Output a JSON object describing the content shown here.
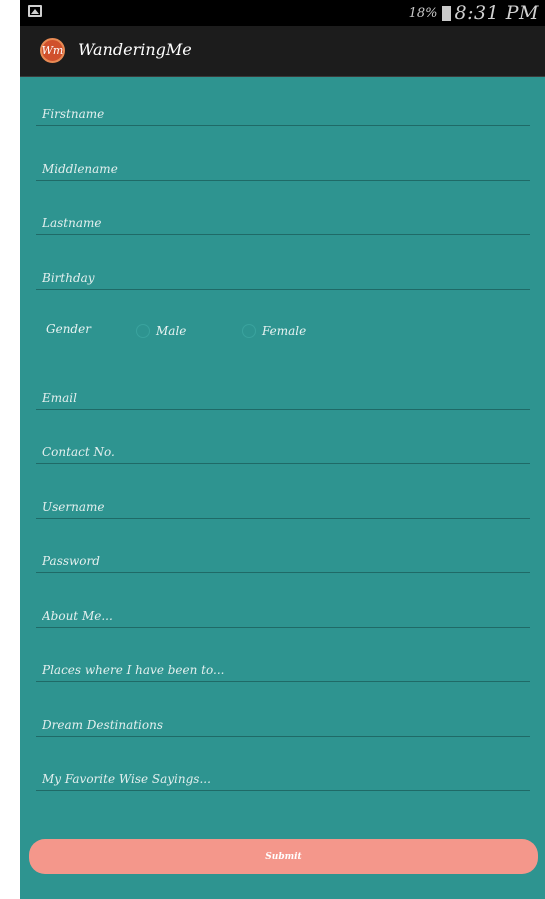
{
  "statusbar": {
    "battery": "18%",
    "time": "8:31 PM"
  },
  "actionbar": {
    "title": "WanderingMe",
    "logo_text": "Wm"
  },
  "form": {
    "firstname": "Firstname",
    "middlename": "Middlename",
    "lastname": "Lastname",
    "birthday": "Birthday",
    "gender_label": "Gender",
    "gender_male": "Male",
    "gender_female": "Female",
    "email": "Email",
    "contact": "Contact No.",
    "username": "Username",
    "password": "Password",
    "about": "About Me...",
    "places": "Places where I have been to...",
    "dreams": "Dream Destinations",
    "sayings": "My Favorite Wise Sayings...",
    "submit": "Submit"
  },
  "colors": {
    "background": "#2e9490",
    "button": "#f4978b",
    "actionbar": "#1c1c1c"
  }
}
